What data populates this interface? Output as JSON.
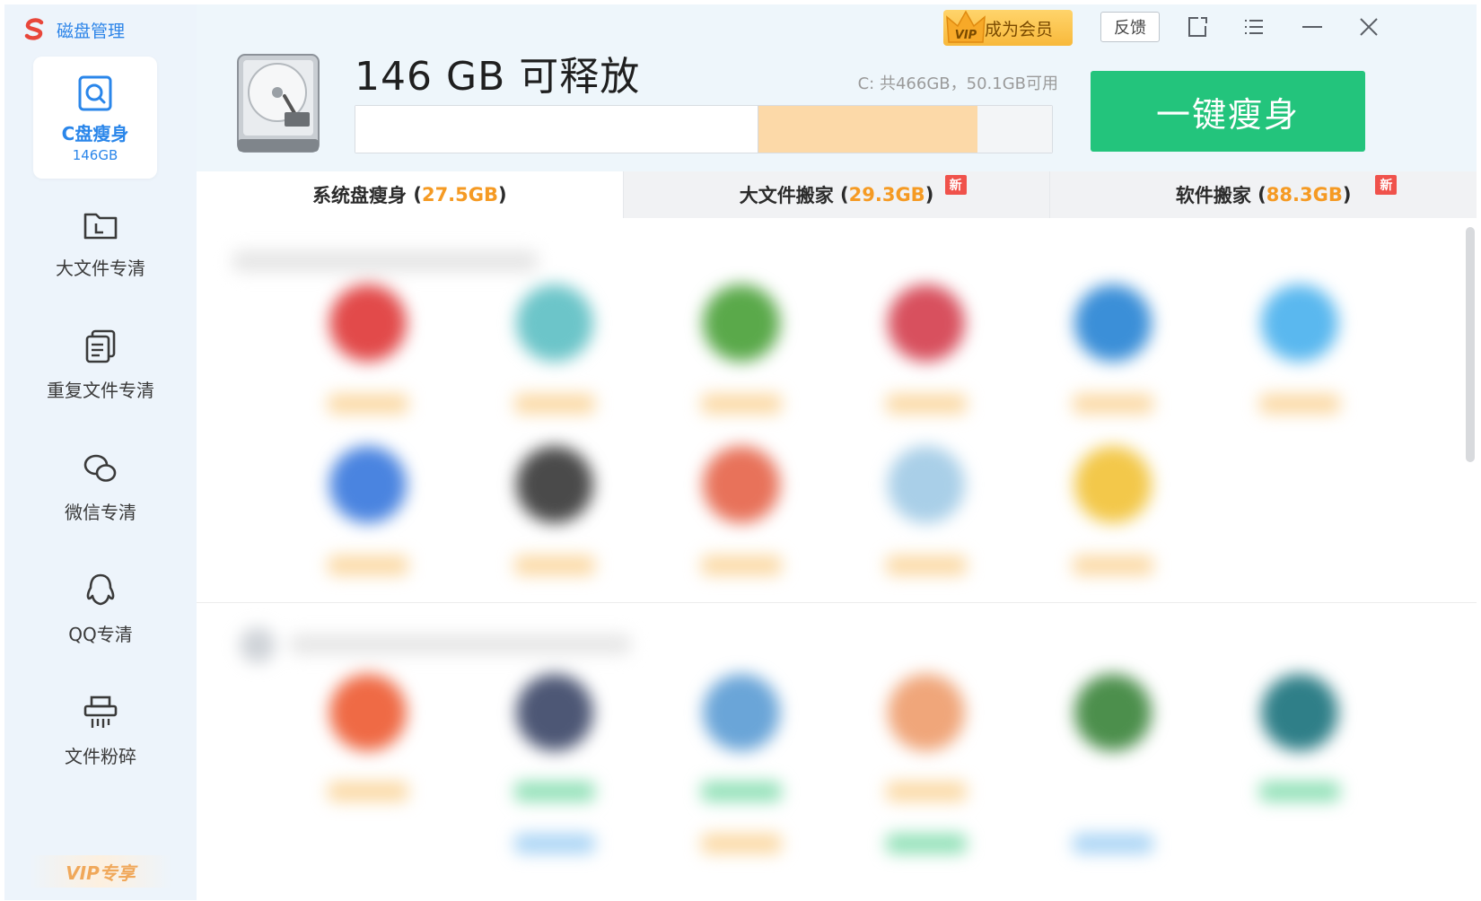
{
  "app": {
    "title": "磁盘管理",
    "logo_icon": "sogou-logo-icon",
    "brand_color": "#e8463a"
  },
  "sidebar": {
    "items": [
      {
        "label": "C盘瘦身",
        "sub": "146GB",
        "icon": "disk-search-icon",
        "active": true
      },
      {
        "label": "大文件专清",
        "icon": "folder-large-icon"
      },
      {
        "label": "重复文件专清",
        "icon": "duplicate-files-icon"
      },
      {
        "label": "微信专清",
        "icon": "wechat-icon"
      },
      {
        "label": "QQ专清",
        "icon": "qq-icon"
      },
      {
        "label": "文件粉碎",
        "icon": "shredder-icon"
      }
    ],
    "vip_exclusive": "VIP专享",
    "active_color": "#2a86ea"
  },
  "header": {
    "free_title": "146 GB  可释放",
    "disk_info": "C: 共466GB，50.1GB可用",
    "usage": {
      "total_gb": 466,
      "releasable_gb": 146,
      "available_gb": 50.1
    },
    "slim_button": "一键瘦身",
    "slim_button_color": "#23c47c",
    "vip_badge": "成为会员",
    "vip_crown_text": "VIP",
    "feedback": "反馈",
    "window_controls": [
      "share-icon",
      "menu-icon",
      "minimize-icon",
      "close-icon"
    ]
  },
  "tabs": [
    {
      "label": "系统盘瘦身",
      "size": "27.5GB",
      "new": false
    },
    {
      "label": "大文件搬家",
      "size": "29.3GB",
      "new": true
    },
    {
      "label": "软件搬家",
      "size": "88.3GB",
      "new": true
    }
  ],
  "new_badge_text": "新",
  "accent_orange": "#f59a23"
}
